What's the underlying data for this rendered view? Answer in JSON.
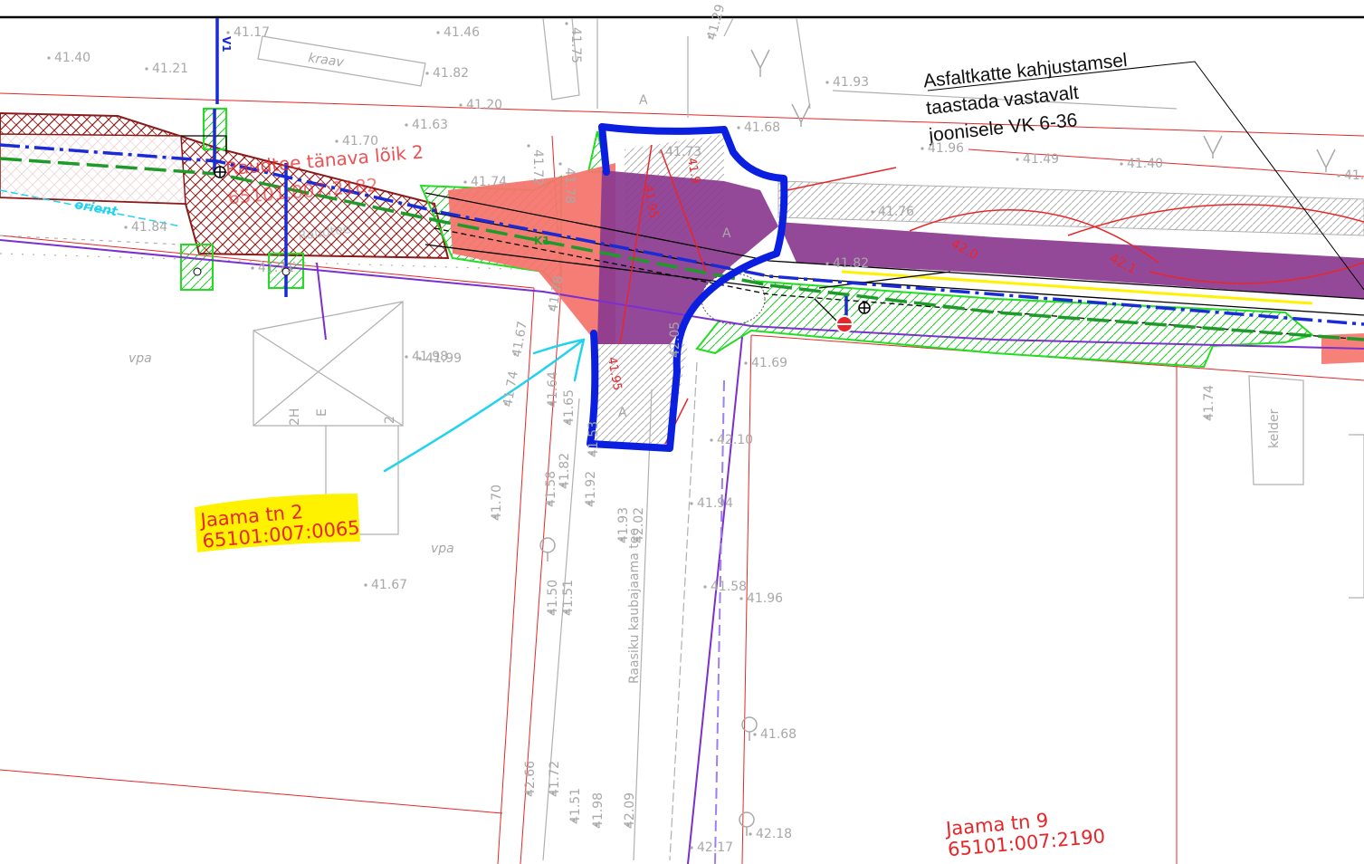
{
  "annotation": {
    "line1": "Asfaltkatte kahjustamsel",
    "line2": "taastada vastavalt",
    "line3": "joonisele VK 6-36"
  },
  "parcels": {
    "jaama2": {
      "name": "Jaama tn 2",
      "code": "65101:007:0065"
    },
    "jaama9": {
      "name": "Jaama tn 9",
      "code": "65101:007:2190"
    },
    "street_segment": "Raudtee tänava lõik 2",
    "street_code": "65101:007:2182"
  },
  "labels": {
    "road_name": "Raasiku kaubajaama tee",
    "road_name_top": "Raudtee",
    "kraav": "kraav",
    "keller": "kelder",
    "vpa1": "vpa",
    "vpa2": "vpa",
    "orient": "orient",
    "building_2h": "2H",
    "building_e": "E",
    "building_2": "2",
    "letter_a1": "A",
    "letter_a2": "A",
    "letter_a3": "A"
  },
  "contours": [
    "41.95",
    "42.0",
    "42.1",
    "41.95",
    "41.9"
  ],
  "utility_codes": {
    "water": "V1",
    "sewer": "K1"
  },
  "elevations": [
    "41.40",
    "41.21",
    "41.17",
    "41.46",
    "41.75",
    "41.29",
    "41.82",
    "41.20",
    "41.70",
    "41.63",
    "41.68",
    "41.73",
    "41.96",
    "41.49",
    "41.40",
    "41.62",
    "41.74",
    "41.72",
    "41.78",
    "41.98",
    "41.78",
    "41.67",
    "41.74",
    "41.64",
    "41.65",
    "41.58",
    "41.82",
    "41.53",
    "41.92",
    "41.93",
    "42.02",
    "42.10",
    "42.05",
    "41.69",
    "41.99",
    "41.70",
    "41.67",
    "41.50",
    "41.51",
    "41.58",
    "41.96",
    "41.94",
    "41.74",
    "41.68",
    "42.66",
    "41.72",
    "41.51",
    "41.98",
    "42.09",
    "42.17",
    "42.18",
    "41.93",
    "41.82",
    "41.84",
    "41.71",
    "41.76"
  ],
  "colors": {
    "water_line": "#1a2bd6",
    "sewer_line": "#1e9a2a",
    "gas_line": "#7b2fd0",
    "parcel_border": "#e8262a",
    "repair_zone": "#8b3a8f",
    "markup": "#0a1fe0",
    "markup_cyan": "#22d3ee",
    "highlight": "#fff200"
  }
}
